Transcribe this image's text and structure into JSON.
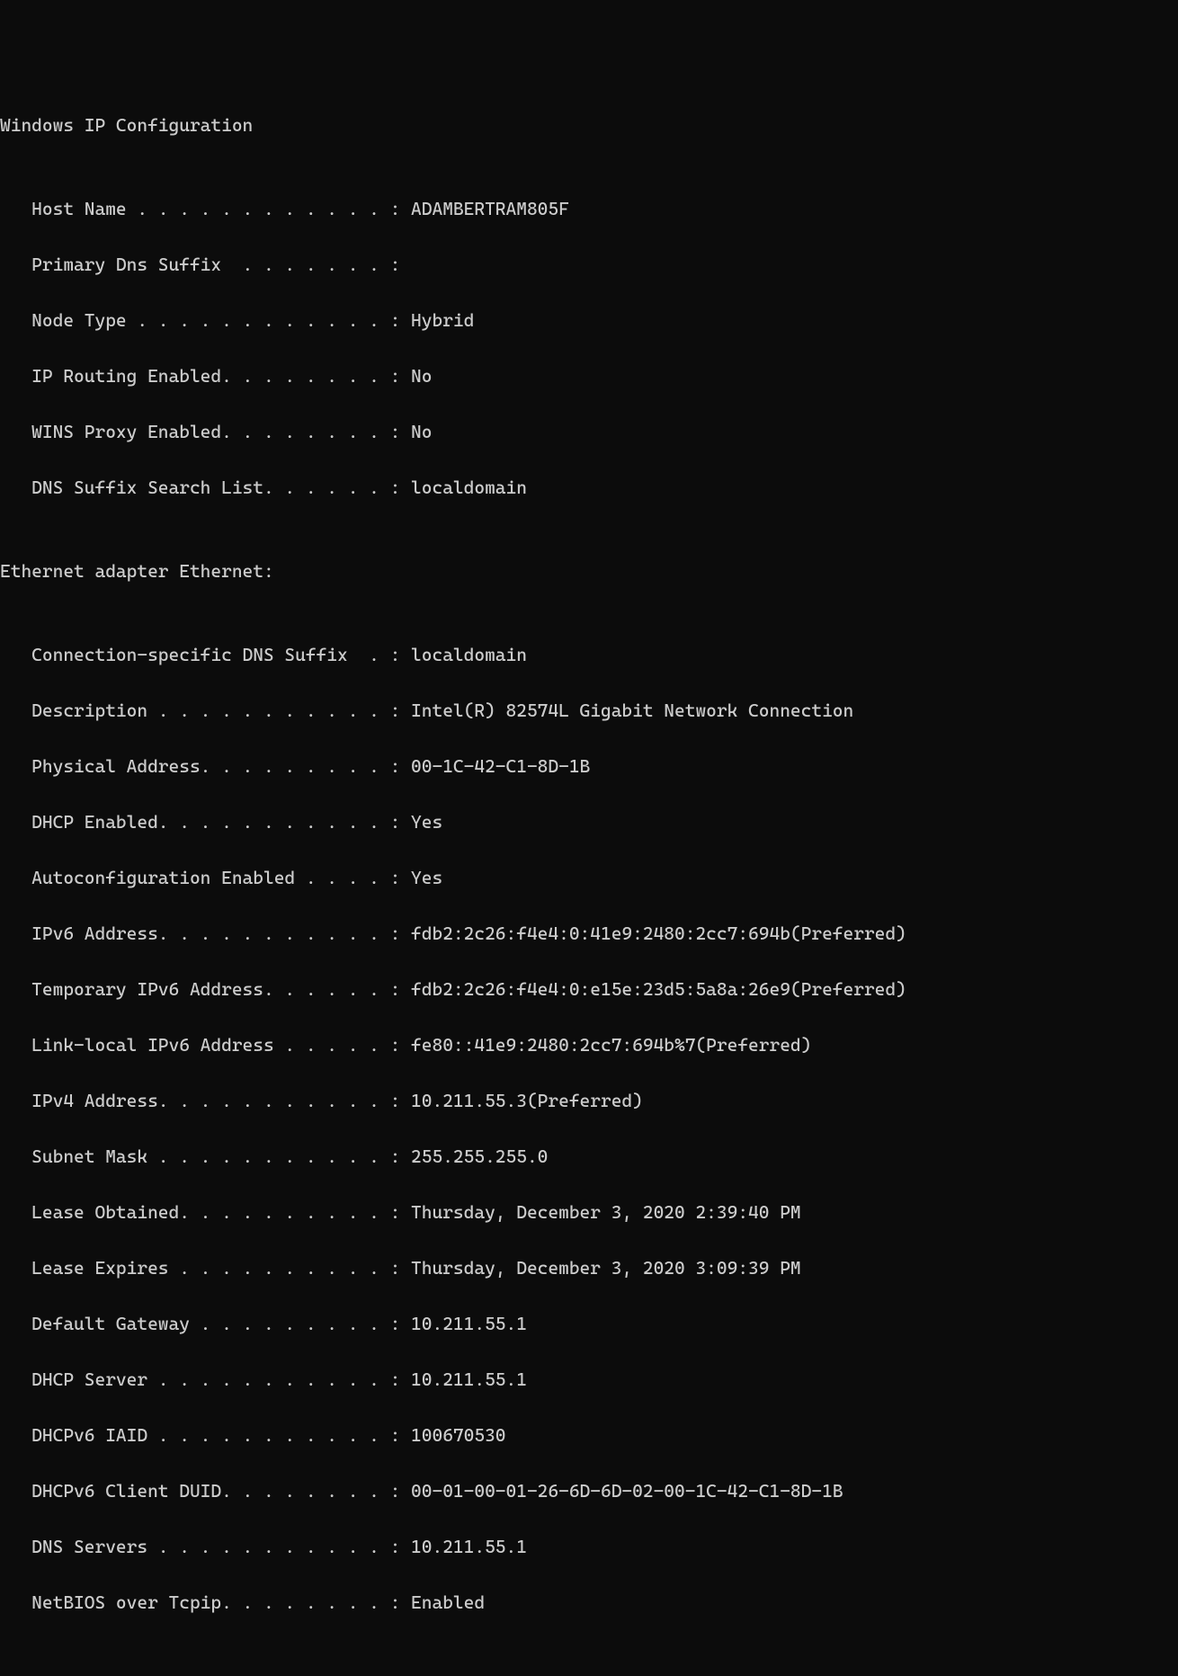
{
  "header": {
    "title": "Windows IP Configuration"
  },
  "ipconfig": {
    "host_name_label": "   Host Name . . . . . . . . . . . . : ",
    "host_name": "ADAMBERTRAM805F",
    "primary_dns_suffix_label": "   Primary Dns Suffix  . . . . . . . :",
    "primary_dns_suffix": "",
    "node_type_label": "   Node Type . . . . . . . . . . . . : ",
    "node_type": "Hybrid",
    "ip_routing_label": "   IP Routing Enabled. . . . . . . . : ",
    "ip_routing": "No",
    "wins_proxy_label": "   WINS Proxy Enabled. . . . . . . . : ",
    "wins_proxy": "No",
    "dns_suffix_list_label": "   DNS Suffix Search List. . . . . . : ",
    "dns_suffix_list": "localdomain"
  },
  "adapter": {
    "heading": "Ethernet adapter Ethernet:",
    "conn_dns_suffix_label": "   Connection-specific DNS Suffix  . : ",
    "conn_dns_suffix": "localdomain",
    "description_label": "   Description . . . . . . . . . . . : ",
    "description": "Intel(R) 82574L Gigabit Network Connection",
    "physical_address_label": "   Physical Address. . . . . . . . . : ",
    "physical_address": "00-1C-42-C1-8D-1B",
    "dhcp_enabled_label": "   DHCP Enabled. . . . . . . . . . . : ",
    "dhcp_enabled": "Yes",
    "autoconfig_label": "   Autoconfiguration Enabled . . . . : ",
    "autoconfig": "Yes",
    "ipv6_address_label": "   IPv6 Address. . . . . . . . . . . : ",
    "ipv6_address": "fdb2:2c26:f4e4:0:41e9:2480:2cc7:694b(Preferred)",
    "temp_ipv6_label": "   Temporary IPv6 Address. . . . . . : ",
    "temp_ipv6": "fdb2:2c26:f4e4:0:e15e:23d5:5a8a:26e9(Preferred)",
    "link_local_ipv6_label": "   Link-local IPv6 Address . . . . . : ",
    "link_local_ipv6": "fe80::41e9:2480:2cc7:694b%7(Preferred)",
    "ipv4_address_label": "   IPv4 Address. . . . . . . . . . . : ",
    "ipv4_address": "10.211.55.3(Preferred)",
    "subnet_mask_label": "   Subnet Mask . . . . . . . . . . . : ",
    "subnet_mask": "255.255.255.0",
    "lease_obtained_label": "   Lease Obtained. . . . . . . . . . : ",
    "lease_obtained": "Thursday, December 3, 2020 2:39:40 PM",
    "lease_expires_label": "   Lease Expires . . . . . . . . . . : ",
    "lease_expires": "Thursday, December 3, 2020 3:09:39 PM",
    "default_gateway_label": "   Default Gateway . . . . . . . . . : ",
    "default_gateway": "10.211.55.1",
    "dhcp_server_label": "   DHCP Server . . . . . . . . . . . : ",
    "dhcp_server": "10.211.55.1",
    "dhcpv6_iaid_label": "   DHCPv6 IAID . . . . . . . . . . . : ",
    "dhcpv6_iaid": "100670530",
    "dhcpv6_duid_label": "   DHCPv6 Client DUID. . . . . . . . : ",
    "dhcpv6_duid": "00-01-00-01-26-6D-6D-02-00-1C-42-C1-8D-1B",
    "dns_servers_label": "   DNS Servers . . . . . . . . . . . : ",
    "dns_servers": "10.211.55.1",
    "netbios_label": "   NetBIOS over Tcpip. . . . . . . . : ",
    "netbios": "Enabled"
  }
}
